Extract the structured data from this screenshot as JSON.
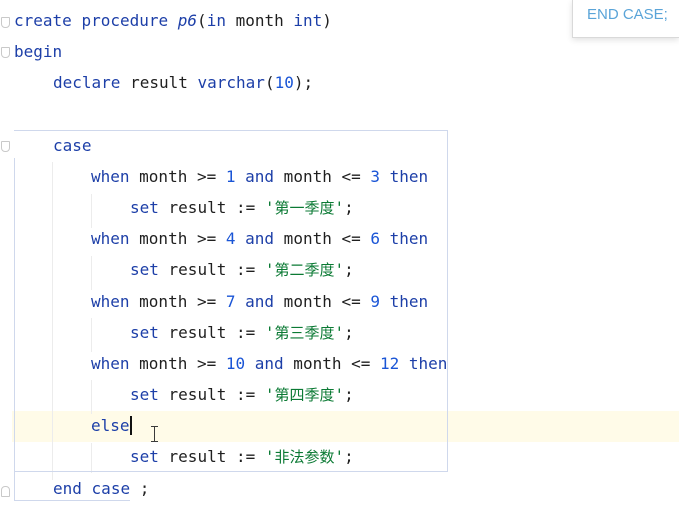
{
  "popup": {
    "text": "END CASE;"
  },
  "code": {
    "line1": {
      "create": "create",
      "procedure": "procedure",
      "name": "p6",
      "open": "(",
      "in": "in",
      "param": " month ",
      "type": "int",
      "close": ")"
    },
    "line2": {
      "begin": "begin"
    },
    "line3": {
      "declare": "declare",
      "var": " result ",
      "type": "varchar",
      "open": "(",
      "size": "10",
      "close": ");"
    },
    "line5": {
      "case": "case"
    },
    "when1": {
      "when": "when",
      "cond1": " month >= ",
      "n1": "1",
      "and": "and",
      "cond2": " month <= ",
      "n2": "3",
      "then": "then"
    },
    "set1": {
      "set": "set",
      "assign": " result := ",
      "q1": "'",
      "value": "第一季度",
      "q2": "'",
      "semi": ";"
    },
    "when2": {
      "when": "when",
      "cond1": " month >= ",
      "n1": "4",
      "and": "and",
      "cond2": " month <= ",
      "n2": "6",
      "then": "then"
    },
    "set2": {
      "set": "set",
      "assign": " result := ",
      "q1": "'",
      "value": "第二季度",
      "q2": "'",
      "semi": ";"
    },
    "when3": {
      "when": "when",
      "cond1": " month >= ",
      "n1": "7",
      "and": "and",
      "cond2": " month <= ",
      "n2": "9",
      "then": "then"
    },
    "set3": {
      "set": "set",
      "assign": " result := ",
      "q1": "'",
      "value": "第三季度",
      "q2": "'",
      "semi": ";"
    },
    "when4": {
      "when": "when",
      "cond1": " month >= ",
      "n1": "10",
      "and": "and",
      "cond2": " month <= ",
      "n2": "12",
      "then": "then"
    },
    "set4": {
      "set": "set",
      "assign": " result := ",
      "q1": "'",
      "value": "第四季度",
      "q2": "'",
      "semi": ";"
    },
    "else_line": {
      "else": "else"
    },
    "set5": {
      "set": "set",
      "assign": " result := ",
      "q1": "'",
      "value": "非法参数",
      "q2": "'",
      "semi": ";"
    },
    "end_line": {
      "end": "end",
      "case": "case",
      "semi": ";"
    }
  }
}
